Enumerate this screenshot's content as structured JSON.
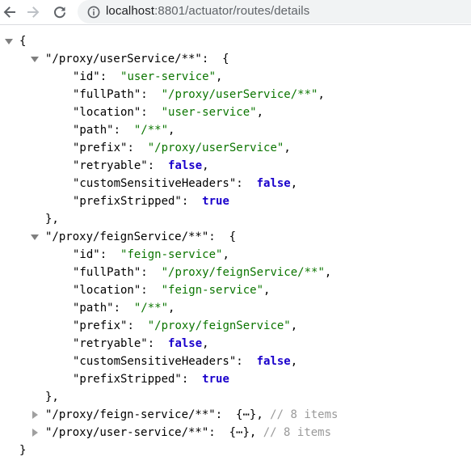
{
  "browser": {
    "url_host": "localhost",
    "url_rest": ":8801/actuator/routes/details"
  },
  "json_viewer": {
    "open_brace": "{",
    "close_brace": "}",
    "routes": [
      {
        "key": "\"/proxy/userService/**\"",
        "expanded": true,
        "fields": [
          {
            "key": "\"id\"",
            "value": "\"user-service\"",
            "type": "string"
          },
          {
            "key": "\"fullPath\"",
            "value": "\"/proxy/userService/**\"",
            "type": "string"
          },
          {
            "key": "\"location\"",
            "value": "\"user-service\"",
            "type": "string"
          },
          {
            "key": "\"path\"",
            "value": "\"/**\"",
            "type": "string"
          },
          {
            "key": "\"prefix\"",
            "value": "\"/proxy/userService\"",
            "type": "string"
          },
          {
            "key": "\"retryable\"",
            "value": "false",
            "type": "bool"
          },
          {
            "key": "\"customSensitiveHeaders\"",
            "value": "false",
            "type": "bool"
          },
          {
            "key": "\"prefixStripped\"",
            "value": "true",
            "type": "bool"
          }
        ]
      },
      {
        "key": "\"/proxy/feignService/**\"",
        "expanded": true,
        "fields": [
          {
            "key": "\"id\"",
            "value": "\"feign-service\"",
            "type": "string"
          },
          {
            "key": "\"fullPath\"",
            "value": "\"/proxy/feignService/**\"",
            "type": "string"
          },
          {
            "key": "\"location\"",
            "value": "\"feign-service\"",
            "type": "string"
          },
          {
            "key": "\"path\"",
            "value": "\"/**\"",
            "type": "string"
          },
          {
            "key": "\"prefix\"",
            "value": "\"/proxy/feignService\"",
            "type": "string"
          },
          {
            "key": "\"retryable\"",
            "value": "false",
            "type": "bool"
          },
          {
            "key": "\"customSensitiveHeaders\"",
            "value": "false",
            "type": "bool"
          },
          {
            "key": "\"prefixStripped\"",
            "value": "true",
            "type": "bool"
          }
        ]
      },
      {
        "key": "\"/proxy/feign-service/**\"",
        "expanded": false,
        "collapsed_preview": "{⋯}",
        "item_count_comment": "// 8 items"
      },
      {
        "key": "\"/proxy/user-service/**\"",
        "expanded": false,
        "collapsed_preview": "{⋯}",
        "item_count_comment": "// 8 items"
      }
    ]
  },
  "colors": {
    "string": "#0b7500",
    "boolean": "#1a01cc",
    "comment": "#9a9a9a"
  }
}
